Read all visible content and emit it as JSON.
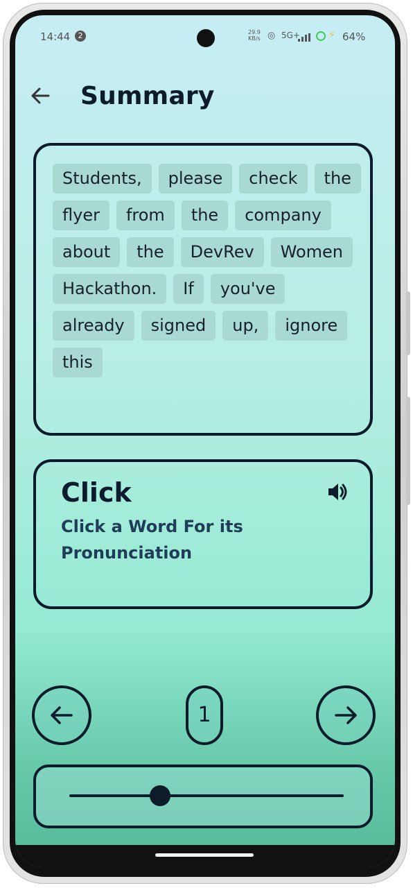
{
  "status_bar": {
    "time": "14:44",
    "notification_count": "2",
    "net_speed_value": "29.9",
    "net_speed_unit": "KB/s",
    "network": "5G+",
    "battery": "64%"
  },
  "header": {
    "title": "Summary",
    "back_icon": "arrow-left-icon"
  },
  "words": [
    "Students,",
    "please",
    "check",
    "the",
    "flyer",
    "from",
    "the",
    "company",
    "about",
    "the",
    "DevRev",
    "Women",
    "Hackathon.",
    "If",
    "you've",
    "already",
    "signed",
    "up,",
    "ignore",
    "this"
  ],
  "selected_word": {
    "title": "Click",
    "subtitle": "Click a Word For its Pronunciation",
    "speaker_icon": "speaker-icon"
  },
  "pager": {
    "page": "1",
    "prev_icon": "arrow-left-circle-icon",
    "next_icon": "arrow-right-circle-icon"
  },
  "slider": {
    "value_fraction": 0.33
  },
  "colors": {
    "ink": "#0d1b2a",
    "chip": "#a9d9d3",
    "bg_top": "#c6edf4",
    "bg_bottom": "#52b898"
  }
}
